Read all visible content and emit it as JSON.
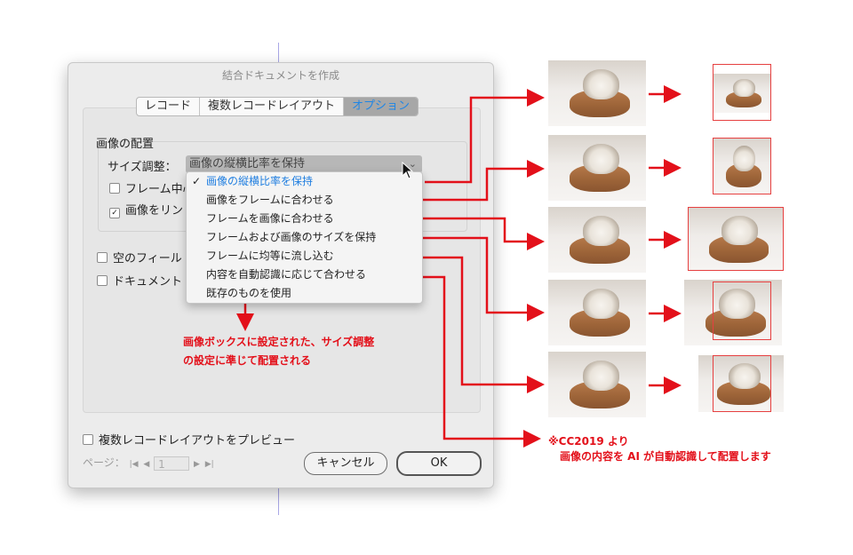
{
  "dialog": {
    "title": "結合ドキュメントを作成",
    "tabs": [
      {
        "label": "レコード",
        "active": false
      },
      {
        "label": "複数レコードレイアウト",
        "active": false
      },
      {
        "label": "オプション",
        "active": true
      }
    ],
    "group_label": "画像の配置",
    "size_label": "サイズ調整：",
    "size_selected": "画像の縦横比率を保持",
    "checkboxes": [
      {
        "label": "フレーム中心",
        "checked": false
      },
      {
        "label": "画像をリン",
        "checked": true
      },
      {
        "label": "空のフィール",
        "checked": false
      },
      {
        "label": "ドキュメント",
        "checked": false
      }
    ],
    "preview_label": "複数レコードレイアウトをプレビュー",
    "page_label": "ページ：",
    "page_value": "1",
    "cancel_label": "キャンセル",
    "ok_label": "OK"
  },
  "dropdown": {
    "items": [
      {
        "label": "画像の縦横比率を保持",
        "selected": true
      },
      {
        "label": "画像をフレームに合わせる",
        "selected": false
      },
      {
        "label": "フレームを画像に合わせる",
        "selected": false
      },
      {
        "label": "フレームおよび画像のサイズを保持",
        "selected": false
      },
      {
        "label": "フレームに均等に流し込む",
        "selected": false
      },
      {
        "label": "内容を自動認識に応じて合わせる",
        "selected": false
      },
      {
        "label": "既存のものを使用",
        "selected": false
      }
    ]
  },
  "annotations": {
    "note_left_line1": "画像ボックスに設定された、サイズ調整",
    "note_left_line2": "の設定に準じて配置される",
    "note_right_line1": "※CC2019 より",
    "note_right_line2": "画像の内容を AI が自動認識して配置します"
  },
  "colors": {
    "accent_blue": "#1f86e6",
    "annotation_red": "#e3101a"
  }
}
